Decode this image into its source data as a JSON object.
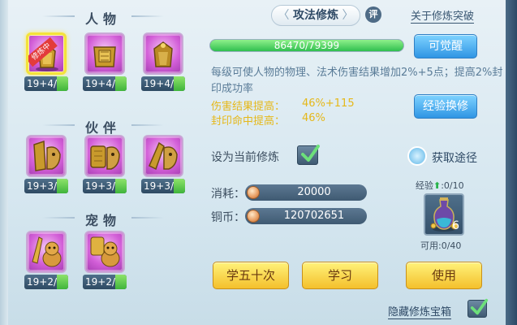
{
  "left": {
    "sections": [
      {
        "title": "人物",
        "slots": [
          {
            "level": "19+4/",
            "badge": "修炼中",
            "selected": true,
            "icon": "armor-icon"
          },
          {
            "level": "19+4/",
            "icon": "armor-icon"
          },
          {
            "level": "19+4/",
            "icon": "armor-icon"
          }
        ]
      },
      {
        "title": "伙伴",
        "slots": [
          {
            "level": "19+3/",
            "icon": "beast-icon"
          },
          {
            "level": "19+3/",
            "icon": "beast-icon"
          },
          {
            "level": "19+3/",
            "icon": "beast-icon"
          }
        ]
      },
      {
        "title": "宠物",
        "slots": [
          {
            "level": "19+2/",
            "icon": "pet-icon"
          },
          {
            "level": "19+2/",
            "icon": "pet-icon"
          }
        ]
      }
    ]
  },
  "main": {
    "title": "攻法修炼",
    "rate_label": "评",
    "about_link": "关于修炼突破",
    "exp": {
      "text": "86470/79399",
      "fill": 1.0
    },
    "awaken_button": "可觉醒",
    "description": "每级可使人物的物理、法术伤害结果增加2%+5点；提高2%封印成功率",
    "stats": [
      {
        "label": "伤害结果提高：",
        "value": "46%+115"
      },
      {
        "label": "封印命中提高：",
        "value": "46%"
      }
    ],
    "exchange_button": "经验换修",
    "set_current_label": "设为当前修炼",
    "set_current_checked": true,
    "obtain_label": "获取途径",
    "cost": {
      "label": "消耗：",
      "value": "20000"
    },
    "coins": {
      "label": "铜币：",
      "value": "120702651"
    },
    "item": {
      "exp_label": "经验",
      "exp_value": ":0/10",
      "count": "6",
      "usable_label": "可用:0/40",
      "icon": "potion-bottle-icon"
    },
    "buttons": {
      "learn50": "学五十次",
      "learn": "学习",
      "use": "使用"
    },
    "hide_label": "隐藏修炼宝箱",
    "hide_checked": true
  },
  "colors": {
    "accent_blue": "#2f95e4",
    "accent_yellow": "#f4c02c",
    "stat_gold": "#e5b81a",
    "exp_green": "#2fbf4f"
  }
}
